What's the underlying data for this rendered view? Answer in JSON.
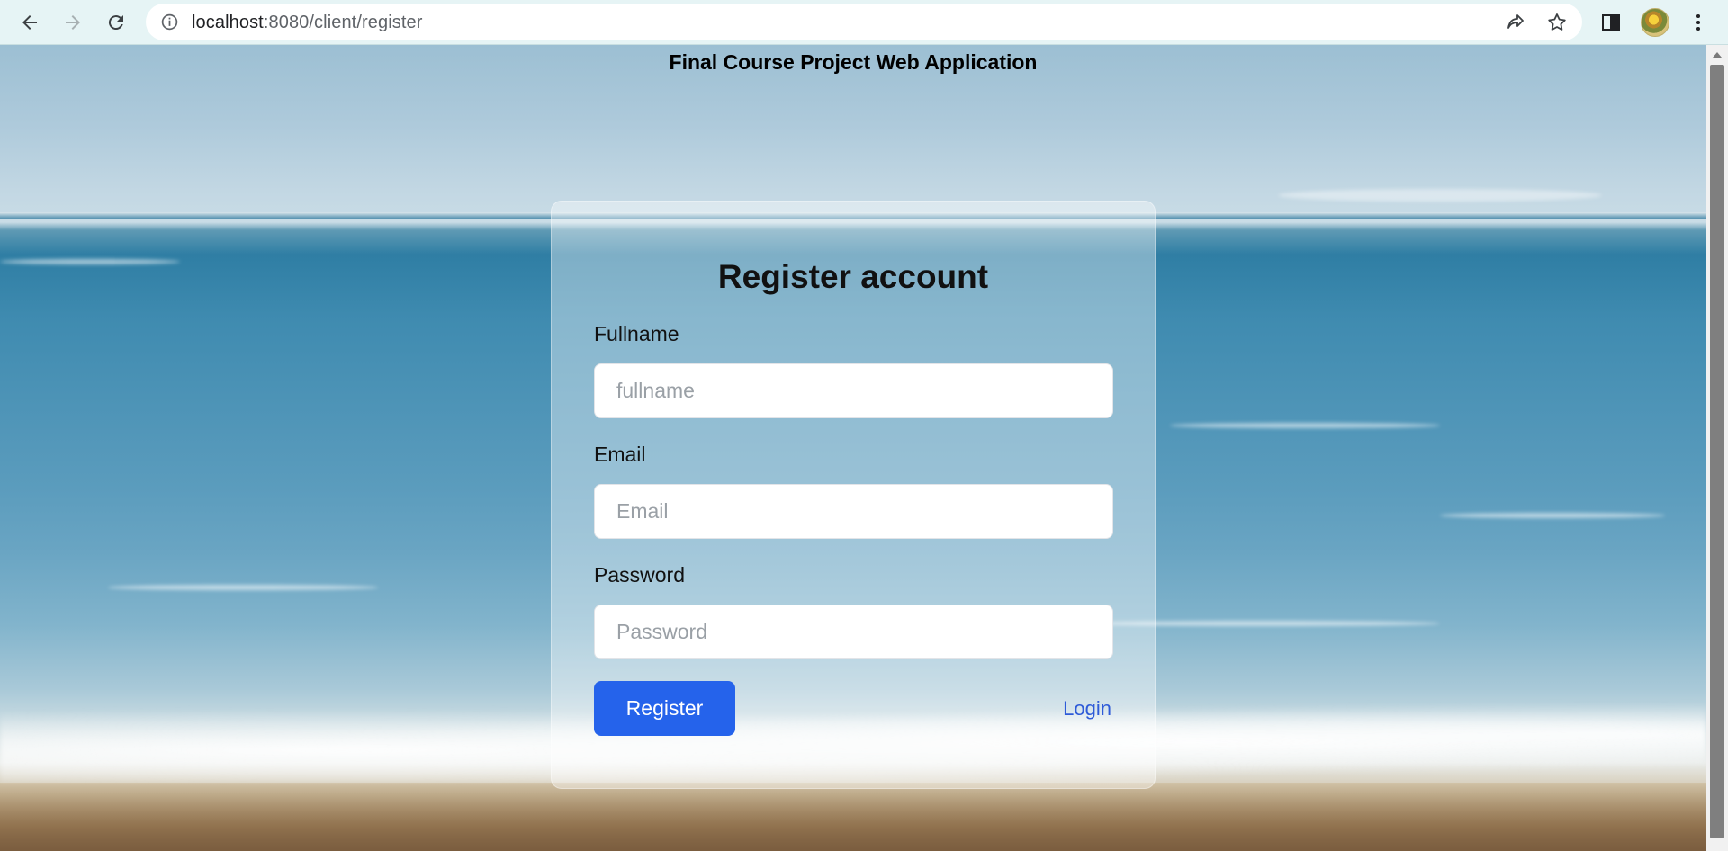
{
  "browser": {
    "url_host": "localhost",
    "url_rest": ":8080/client/register",
    "icons": {
      "back": "arrow-left-icon",
      "forward": "arrow-right-icon",
      "reload": "reload-icon",
      "info": "info-icon",
      "share": "share-icon",
      "bookmark": "star-icon",
      "side_panel": "side-panel-icon",
      "profile": "avatar",
      "menu": "more-vert-icon"
    }
  },
  "page": {
    "title": "Final Course Project Web Application"
  },
  "form": {
    "heading": "Register account",
    "fullname_label": "Fullname",
    "fullname_placeholder": "fullname",
    "fullname_value": "",
    "email_label": "Email",
    "email_placeholder": "Email",
    "email_value": "",
    "password_label": "Password",
    "password_placeholder": "Password",
    "password_value": "",
    "register_label": "Register",
    "login_label": "Login"
  },
  "colors": {
    "primary_button": "#2563eb",
    "link": "#2e5bd8",
    "toolbar": "#e6f4f5"
  }
}
